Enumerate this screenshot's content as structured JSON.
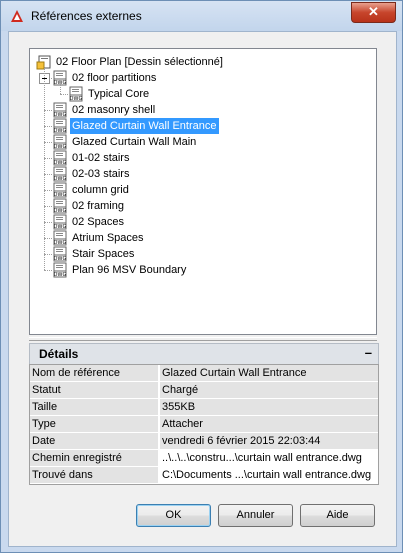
{
  "window": {
    "title": "Références externes",
    "close_label": "✕"
  },
  "tree": {
    "root": {
      "label": "02 Floor Plan [Dessin sélectionné]",
      "icon": "drawing-root-icon"
    },
    "items": [
      {
        "label": "02 floor partitions",
        "icon": "dwg-file-icon",
        "level": 1,
        "expanded": true
      },
      {
        "label": "Typical Core",
        "icon": "dwg-file-icon",
        "level": 2
      },
      {
        "label": "02 masonry shell",
        "icon": "dwg-file-icon",
        "level": 1
      },
      {
        "label": "Glazed Curtain Wall Entrance",
        "icon": "dwg-file-icon",
        "level": 1,
        "selected": true
      },
      {
        "label": "Glazed Curtain Wall Main",
        "icon": "dwg-file-icon",
        "level": 1
      },
      {
        "label": "01-02 stairs",
        "icon": "dwg-file-icon",
        "level": 1
      },
      {
        "label": "02-03 stairs",
        "icon": "dwg-file-icon",
        "level": 1
      },
      {
        "label": "column grid",
        "icon": "dwg-file-icon",
        "level": 1
      },
      {
        "label": "02 framing",
        "icon": "dwg-file-icon",
        "level": 1
      },
      {
        "label": "02 Spaces",
        "icon": "dwg-file-icon",
        "level": 1
      },
      {
        "label": "Atrium Spaces",
        "icon": "dwg-file-icon",
        "level": 1
      },
      {
        "label": "Stair Spaces",
        "icon": "dwg-file-icon",
        "level": 1
      },
      {
        "label": "Plan 96 MSV Boundary",
        "icon": "dwg-file-icon",
        "level": 1
      }
    ]
  },
  "details": {
    "title": "Détails",
    "collapse_label": "–",
    "rows": [
      {
        "key": "Nom de référence",
        "value": "Glazed Curtain Wall Entrance"
      },
      {
        "key": "Statut",
        "value": "Chargé"
      },
      {
        "key": "Taille",
        "value": "355KB"
      },
      {
        "key": "Type",
        "value": "Attacher"
      },
      {
        "key": "Date",
        "value": "vendredi 6 février 2015  22:03:44"
      },
      {
        "key": "Chemin enregistré",
        "value": "..\\..\\..\\constru...\\curtain wall entrance.dwg"
      },
      {
        "key": "Trouvé dans",
        "value": "C:\\Documents ...\\curtain wall entrance.dwg"
      }
    ]
  },
  "buttons": {
    "ok": "OK",
    "cancel": "Annuler",
    "help": "Aide"
  },
  "colors": {
    "selection": "#3399ff",
    "title_bar": "#c9d9ee",
    "close_button": "#c7452c"
  }
}
